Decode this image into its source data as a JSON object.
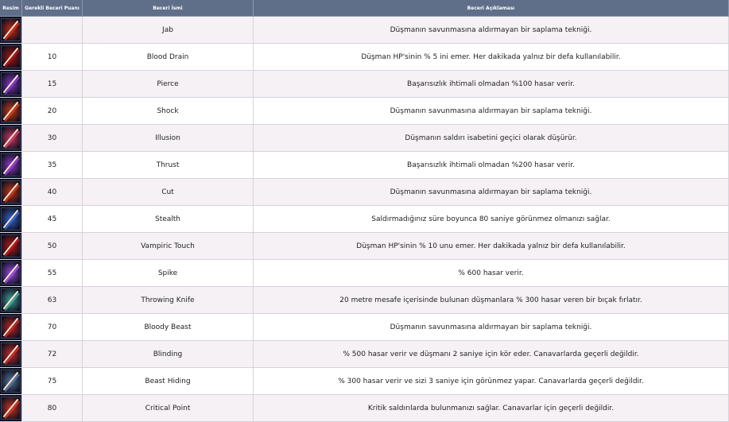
{
  "header": {
    "col_icon": "Resim",
    "col_points": "Gerekli Beceri Puanı",
    "col_name": "Beceri İsmi",
    "col_desc": "Beceri Açıklaması"
  },
  "rows": [
    {
      "points": "",
      "name": "Jab",
      "desc": "Düşmanın savunmasına aldırmayan bir saplama tekniği.",
      "icon": "red-slash-icon",
      "color": "#c8301c"
    },
    {
      "points": "10",
      "name": "Blood Drain",
      "desc": "Düşman HP'sinin % 5 ini emer. Her dakikada yalnız bir defa kullanılabilir.",
      "icon": "blood-blade-icon",
      "color": "#a81818"
    },
    {
      "points": "15",
      "name": "Pierce",
      "desc": "Başarısızlık ihtimali olmadan %100 hasar verir.",
      "icon": "purple-pierce-icon",
      "color": "#8a3cc8"
    },
    {
      "points": "20",
      "name": "Shock",
      "desc": "Düşmanın savunmasına aldırmayan bir saplama tekniği.",
      "icon": "red-shock-icon",
      "color": "#d0401c"
    },
    {
      "points": "30",
      "name": "Illusion",
      "desc": "Düşmanın saldırı isabetini geçici olarak düşürür.",
      "icon": "pink-swirl-icon",
      "color": "#d0406a"
    },
    {
      "points": "35",
      "name": "Thrust",
      "desc": "Başarısızlık ihtimali olmadan %200 hasar verir.",
      "icon": "purple-thrust-icon",
      "color": "#9a40d0"
    },
    {
      "points": "40",
      "name": "Cut",
      "desc": "Düşmanın savunmasına aldırmayan bir saplama tekniği.",
      "icon": "red-cut-icon",
      "color": "#c83a1c"
    },
    {
      "points": "45",
      "name": "Stealth",
      "desc": "Saldırmadığınız süre boyunca 80 saniye görünmez olmanızı sağlar.",
      "icon": "blue-stealth-icon",
      "color": "#3a6ad0"
    },
    {
      "points": "50",
      "name": "Vampiric Touch",
      "desc": "Düşman HP'sinin % 10 unu emer. Her dakikada yalnız bir defa kullanılabilir.",
      "icon": "vampire-blade-icon",
      "color": "#b81c1c"
    },
    {
      "points": "55",
      "name": "Spike",
      "desc": "% 600 hasar verir.",
      "icon": "purple-spike-icon",
      "color": "#a050e0"
    },
    {
      "points": "63",
      "name": "Throwing Knife",
      "desc": "20 metre mesafe içerisinde bulunan düşmanlara % 300 hasar veren bir bıçak fırlatır.",
      "icon": "knife-icon",
      "color": "#4aa8a0"
    },
    {
      "points": "70",
      "name": "Bloody Beast",
      "desc": "Düşmanın savunmasına aldırmayan bir saplama tekniği.",
      "icon": "beast-icon",
      "color": "#c02a2a"
    },
    {
      "points": "72",
      "name": "Blinding",
      "desc": "% 500 hasar verir ve düşmanı 2 saniye için kör eder. Canavarlarda geçerli değildir.",
      "icon": "eye-icon",
      "color": "#c83030"
    },
    {
      "points": "75",
      "name": "Beast Hiding",
      "desc": "% 300 hasar verir ve sizi 3 saniye için görünmez yapar. Canavarlarda geçerli değildir.",
      "icon": "beast-hiding-icon",
      "color": "#5a7aa0"
    },
    {
      "points": "80",
      "name": "Critical Point",
      "desc": "Kritik saldırılarda bulunmanızı sağlar. Canavarlar için geçerli değildir.",
      "icon": "critical-point-icon",
      "color": "#d03a2a"
    }
  ]
}
